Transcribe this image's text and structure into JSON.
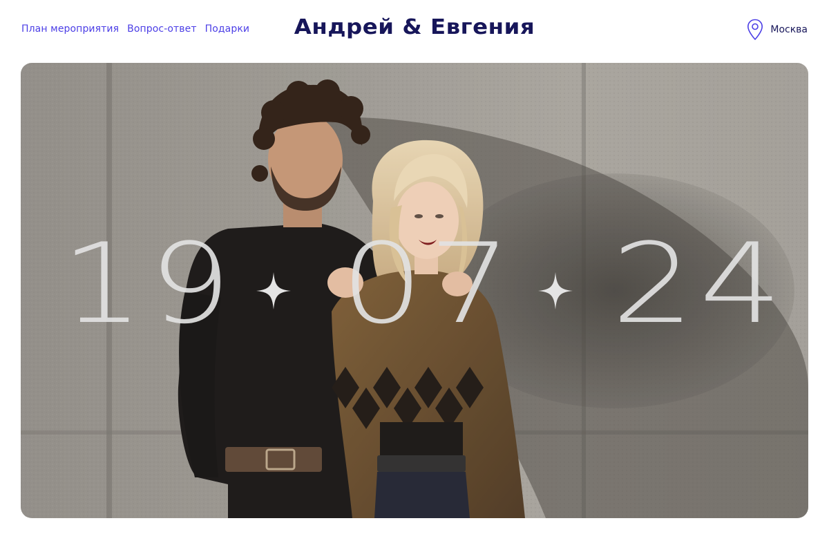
{
  "nav": {
    "items": [
      {
        "label": "План мероприятия"
      },
      {
        "label": "Вопрос-ответ"
      },
      {
        "label": "Подарки"
      }
    ]
  },
  "brand": {
    "title": "Андрей & Евгения"
  },
  "location": {
    "city": "Москва",
    "icon": "map-pin-icon"
  },
  "hero": {
    "date": {
      "day": "19",
      "month": "07",
      "year": "24"
    },
    "separator_icon": "sparkle-icon"
  },
  "colors": {
    "accent": "#4b3ee6",
    "brand": "#17165a",
    "date_text": "#e2e2e2"
  }
}
